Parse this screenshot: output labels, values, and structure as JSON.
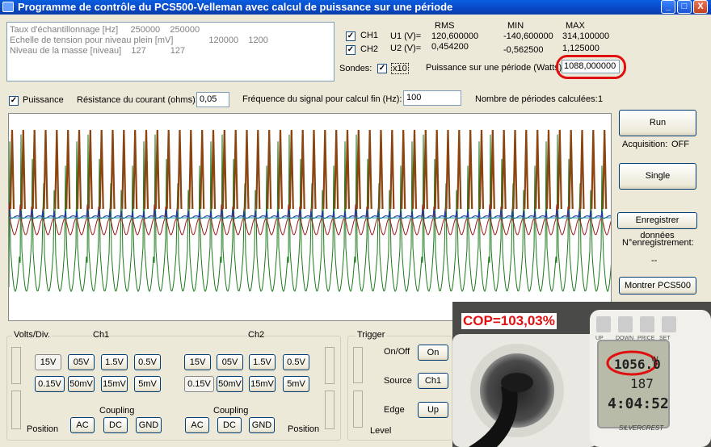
{
  "window": {
    "title": "Programme de contrôle du PCS500-Velleman avec calcul de puissance sur une période",
    "min": "_",
    "max": "□",
    "close": "X"
  },
  "info": {
    "rows": [
      {
        "label": "Taux d'échantillonnage [Hz]",
        "v1": "250000",
        "v2": "250000"
      },
      {
        "label": "Echelle de tension pour niveau plein [mV]",
        "v1": "120000",
        "v2": "1200"
      },
      {
        "label": "Niveau de la masse [niveau]",
        "v1": "127",
        "v2": "127"
      }
    ]
  },
  "measure": {
    "headers": {
      "rms": "RMS",
      "min": "MIN",
      "max": "MAX"
    },
    "ch1": {
      "label": "CH1",
      "name": "U1 (V)=",
      "rms": "120,600000",
      "min": "-140,600000",
      "max": "314,100000"
    },
    "ch2": {
      "label": "CH2",
      "name": "U2 (V)=",
      "rms": "0,454200",
      "min": "-0,562500",
      "max": "1,125000"
    },
    "sondes_label": "Sondes:",
    "x10_label": "x10",
    "power_label": "Puissance sur une période (Watts)",
    "power_value": "1088,000000"
  },
  "params": {
    "puissance_label": "Puissance",
    "resistance_label": "Résistance du courant (ohms):",
    "resistance_value": "0,05",
    "freq_label": "Fréquence du signal pour calcul fin (Hz):",
    "freq_value": "100",
    "periods_label": "Nombre de périodes calculées:",
    "periods_value": "1"
  },
  "side": {
    "run": "Run",
    "acquisition_label": "Acquisition:",
    "acquisition_value": "OFF",
    "single": "Single",
    "save": "Enregistrer données",
    "record_label": "N°enregistrement:",
    "record_value": "--",
    "show": "Montrer PCS500"
  },
  "controls": {
    "volts_div": "Volts/Div.",
    "ch1": "Ch1",
    "ch2": "Ch2",
    "row1": [
      "15V",
      "05V",
      "1.5V",
      "0.5V"
    ],
    "row2": [
      "0.15V",
      "50mV",
      "15mV",
      "5mV"
    ],
    "coupling": "Coupling",
    "coupling_opts": [
      "AC",
      "DC",
      "GND"
    ],
    "position": "Position",
    "trigger": "Trigger",
    "onoff_label": "On/Off",
    "onoff_value": "On",
    "source_label": "Source",
    "source_value": "Ch1",
    "edge_label": "Edge",
    "edge_value": "Up",
    "level": "Level"
  },
  "overlay": {
    "cop": "COP=103,03%",
    "meter_power": "1056.0",
    "meter_unit": "W",
    "meter_volts": "187",
    "meter_time": "4:04:52",
    "brand": "SILVERCREST",
    "keys": [
      "UP",
      "DOWN",
      "PRICE",
      "SET"
    ]
  },
  "colors": {
    "ch1_wave": "#1a7a1a",
    "ch2_wave": "#1a3fa8",
    "power_wave": "#8b4510",
    "ref_wave": "#9c1a1a",
    "highlight": "#e01010"
  }
}
